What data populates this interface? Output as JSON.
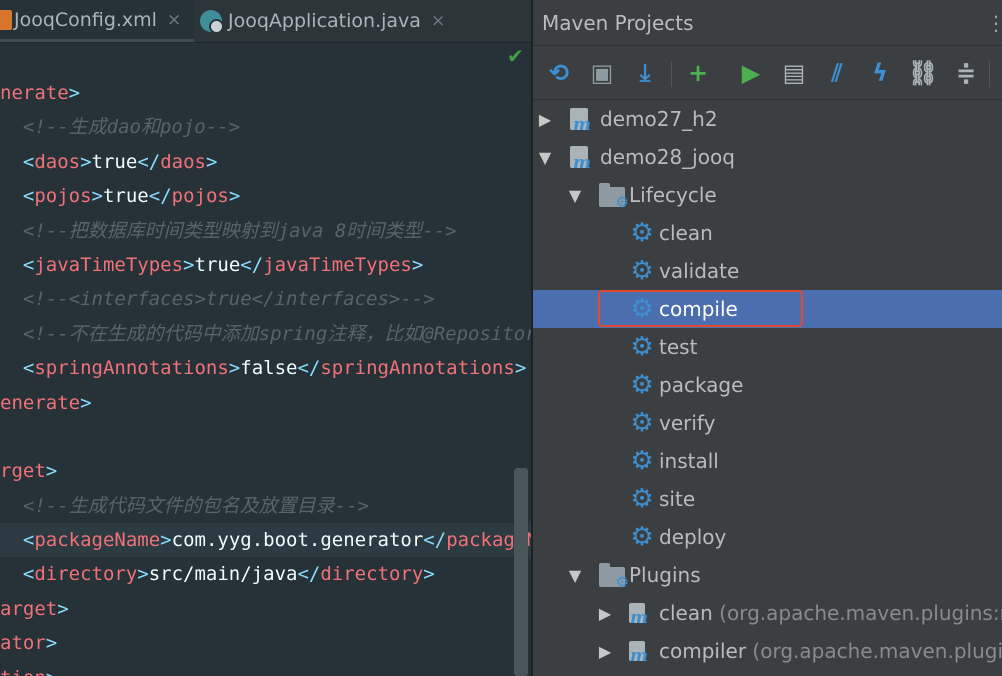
{
  "editor": {
    "tabs": [
      {
        "label": "JooqConfig.xml",
        "close": "×"
      },
      {
        "label": "JooqApplication.java",
        "close": "×"
      }
    ],
    "check": "✔",
    "lines": [
      [
        {
          "c": "tag",
          "t": "nerate"
        },
        {
          "c": "br",
          "t": ">"
        }
      ],
      [
        {
          "c": "cmt",
          "t": "  <!--生成dao和pojo-->"
        }
      ],
      [
        {
          "c": "br",
          "t": "  <"
        },
        {
          "c": "tag",
          "t": "daos"
        },
        {
          "c": "br",
          "t": ">"
        },
        {
          "c": "txt",
          "t": "true"
        },
        {
          "c": "br",
          "t": "</"
        },
        {
          "c": "tag",
          "t": "daos"
        },
        {
          "c": "br",
          "t": ">"
        }
      ],
      [
        {
          "c": "br",
          "t": "  <"
        },
        {
          "c": "tag",
          "t": "pojos"
        },
        {
          "c": "br",
          "t": ">"
        },
        {
          "c": "txt",
          "t": "true"
        },
        {
          "c": "br",
          "t": "</"
        },
        {
          "c": "tag",
          "t": "pojos"
        },
        {
          "c": "br",
          "t": ">"
        }
      ],
      [
        {
          "c": "cmt",
          "t": "  <!--把数据库时间类型映射到java 8时间类型-->"
        }
      ],
      [
        {
          "c": "br",
          "t": "  <"
        },
        {
          "c": "tag",
          "t": "javaTimeTypes"
        },
        {
          "c": "br",
          "t": ">"
        },
        {
          "c": "txt",
          "t": "true"
        },
        {
          "c": "br",
          "t": "</"
        },
        {
          "c": "tag",
          "t": "javaTimeTypes"
        },
        {
          "c": "br",
          "t": ">"
        }
      ],
      [
        {
          "c": "cmt",
          "t": "  <!--<interfaces>true</interfaces>-->"
        }
      ],
      [
        {
          "c": "cmt",
          "t": "  <!--不在生成的代码中添加spring注释，比如@Repositor"
        }
      ],
      [
        {
          "c": "br",
          "t": "  <"
        },
        {
          "c": "tag",
          "t": "springAnnotations"
        },
        {
          "c": "br",
          "t": ">"
        },
        {
          "c": "txt",
          "t": "false"
        },
        {
          "c": "br",
          "t": "</"
        },
        {
          "c": "tag",
          "t": "springAnnotations"
        },
        {
          "c": "br",
          "t": ">"
        }
      ],
      [
        {
          "c": "tag",
          "t": "enerate"
        },
        {
          "c": "br",
          "t": ">"
        }
      ],
      [],
      [
        {
          "c": "tag",
          "t": "rget"
        },
        {
          "c": "br",
          "t": ">"
        }
      ],
      [
        {
          "c": "cmt",
          "t": "  <!--生成代码文件的包名及放置目录-->"
        }
      ],
      [
        {
          "c": "br",
          "t": "  <"
        },
        {
          "c": "tag",
          "t": "packageName"
        },
        {
          "c": "br",
          "t": ">"
        },
        {
          "c": "txt",
          "t": "com.yyg.boot.generator"
        },
        {
          "c": "br",
          "t": "</"
        },
        {
          "c": "tag",
          "t": "packageN"
        }
      ],
      [
        {
          "c": "br",
          "t": "  <"
        },
        {
          "c": "tag",
          "t": "directory"
        },
        {
          "c": "br",
          "t": ">"
        },
        {
          "c": "txt",
          "t": "src/main/java"
        },
        {
          "c": "br",
          "t": "</"
        },
        {
          "c": "tag",
          "t": "directory"
        },
        {
          "c": "br",
          "t": ">"
        }
      ],
      [
        {
          "c": "tag",
          "t": "arget"
        },
        {
          "c": "br",
          "t": ">"
        }
      ],
      [
        {
          "c": "tag",
          "t": "ator"
        },
        {
          "c": "br",
          "t": ">"
        }
      ],
      [
        {
          "c": "tag",
          "t": "tion"
        },
        {
          "c": "br",
          "t": ">"
        }
      ]
    ],
    "highlighted_line": 13
  },
  "maven": {
    "title": "Maven Projects",
    "title_overflow": "⋮",
    "toolbar": [
      {
        "name": "reimport-icon",
        "glyph": "⟲",
        "color": "#3d8fd1"
      },
      {
        "name": "generate-sources-icon",
        "glyph": "▣",
        "color": "#8e9ba3"
      },
      {
        "name": "download-sources-icon",
        "glyph": "⤓",
        "color": "#3d8fd1"
      },
      {
        "name": "add-project-icon",
        "glyph": "+",
        "color": "#4caf50"
      },
      {
        "name": "run-icon",
        "glyph": "▶",
        "color": "#4caf50"
      },
      {
        "name": "execute-goal-icon",
        "glyph": "▤",
        "color": "#a9b3b8"
      },
      {
        "name": "toggle-offline-icon",
        "glyph": "⫽",
        "color": "#3d8fd1"
      },
      {
        "name": "skip-tests-icon",
        "glyph": "ϟ",
        "color": "#3d8fd1"
      },
      {
        "name": "show-dependencies-icon",
        "glyph": "⛓",
        "color": "#a9b3b8"
      },
      {
        "name": "collapse-all-icon",
        "glyph": "≑",
        "color": "#a9b3b8"
      }
    ],
    "tree": [
      {
        "label": "demo27_h2",
        "suffix": "",
        "icon": "maven",
        "arrow": "▶",
        "indent": 0
      },
      {
        "label": "demo28_jooq",
        "suffix": "",
        "icon": "maven",
        "arrow": "▼",
        "indent": 0
      },
      {
        "label": "Lifecycle",
        "suffix": "",
        "icon": "folder",
        "arrow": "▼",
        "indent": 1
      },
      {
        "label": "clean",
        "suffix": "",
        "icon": "gear",
        "arrow": "",
        "indent": 2
      },
      {
        "label": "validate",
        "suffix": "",
        "icon": "gear",
        "arrow": "",
        "indent": 2
      },
      {
        "label": "compile",
        "suffix": "",
        "icon": "gear",
        "arrow": "",
        "indent": 2,
        "selected": true
      },
      {
        "label": "test",
        "suffix": "",
        "icon": "gear",
        "arrow": "",
        "indent": 2
      },
      {
        "label": "package",
        "suffix": "",
        "icon": "gear",
        "arrow": "",
        "indent": 2
      },
      {
        "label": "verify",
        "suffix": "",
        "icon": "gear",
        "arrow": "",
        "indent": 2
      },
      {
        "label": "install",
        "suffix": "",
        "icon": "gear",
        "arrow": "",
        "indent": 2
      },
      {
        "label": "site",
        "suffix": "",
        "icon": "gear",
        "arrow": "",
        "indent": 2
      },
      {
        "label": "deploy",
        "suffix": "",
        "icon": "gear",
        "arrow": "",
        "indent": 2
      },
      {
        "label": "Plugins",
        "suffix": "",
        "icon": "folder",
        "arrow": "▼",
        "indent": 1
      },
      {
        "label": "clean",
        "suffix": " (org.apache.maven.plugins:m",
        "icon": "plugin",
        "arrow": "▶",
        "indent": 2
      },
      {
        "label": "compiler",
        "suffix": " (org.apache.maven.plugins",
        "icon": "plugin",
        "arrow": "▶",
        "indent": 2
      }
    ]
  },
  "colors": {
    "selection": "#4b6eaf",
    "callout": "#e2492f",
    "gear": "#3d8fd1"
  }
}
